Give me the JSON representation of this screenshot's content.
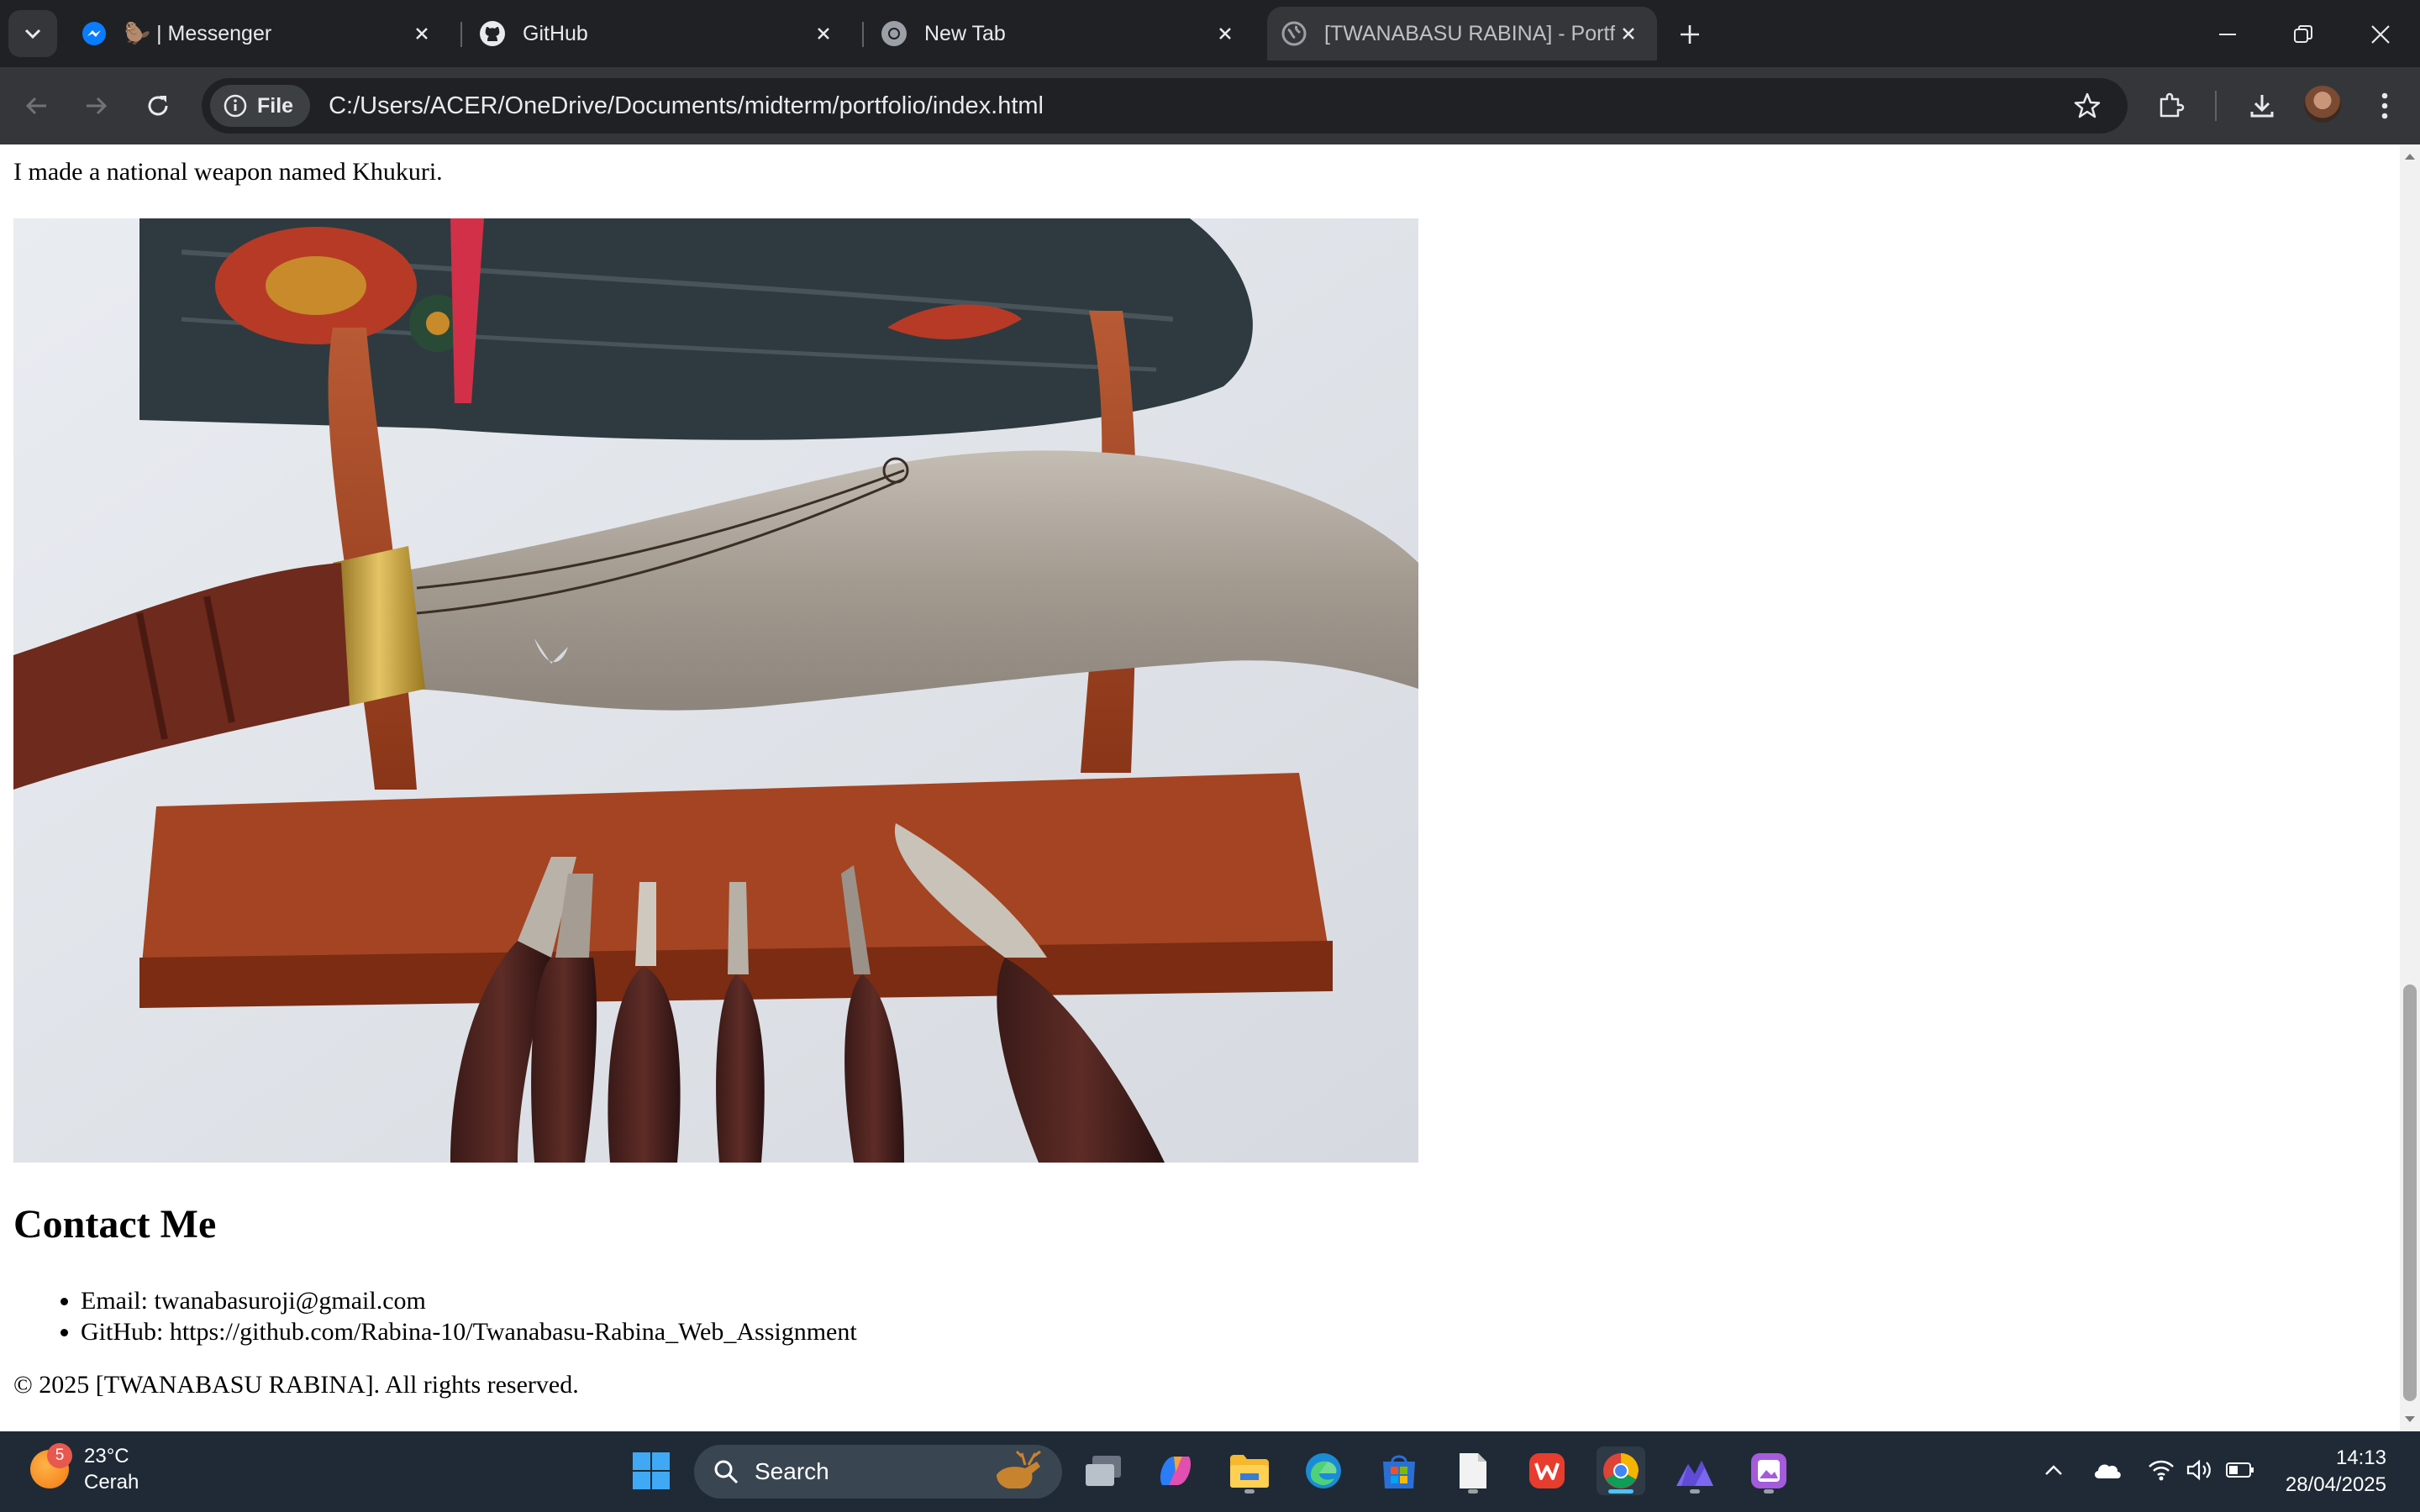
{
  "browser": {
    "tabs": [
      {
        "title": "🦫 | Messenger",
        "favicon": "messenger-icon",
        "active": false
      },
      {
        "title": "GitHub",
        "favicon": "github-icon",
        "active": false
      },
      {
        "title": "New Tab",
        "favicon": "chrome-icon",
        "active": false
      },
      {
        "title": "[TWANABASU RABINA] - Portfo",
        "favicon": "globe-icon",
        "active": true
      }
    ],
    "omnibox": {
      "chip_label": "File",
      "url": "C:/Users/ACER/OneDrive/Documents/midterm/portfolio/index.html"
    }
  },
  "page": {
    "intro_text": "I made a national weapon named Khukuri.",
    "image_subject": "khukuri-photo",
    "contact_heading": "Contact Me",
    "contact_items": [
      "Email: twanabasuroji@gmail.com",
      "GitHub: https://github.com/Rabina-10/Twanabasu-Rabina_Web_Assignment"
    ],
    "footer": "© 2025 [TWANABASU RABINA]. All rights reserved."
  },
  "taskbar": {
    "weather": {
      "badge": "5",
      "temp": "23°C",
      "condition": "Cerah"
    },
    "search_placeholder": "Search",
    "clock": {
      "time": "14:13",
      "date": "28/04/2025"
    }
  },
  "colors": {
    "accent": "#4cc2ff",
    "tab_active": "#35363a",
    "chrome_dark": "#202124"
  }
}
